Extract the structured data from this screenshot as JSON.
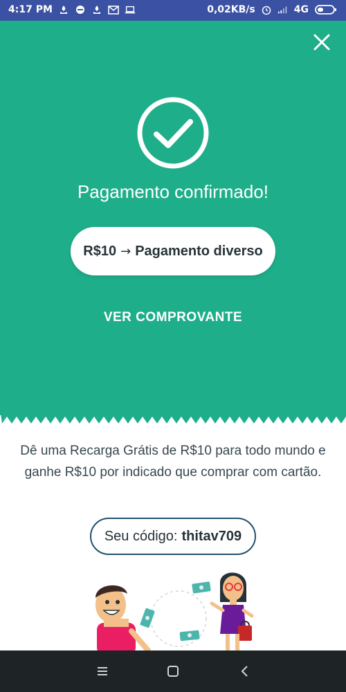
{
  "status_bar": {
    "time": "4:17 PM",
    "network_speed": "0,02KB/s",
    "network_type": "4G",
    "left_icons": [
      "santander-icon",
      "blocked-icon",
      "santander-icon",
      "mail-icon",
      "laptop-icon"
    ],
    "right_icons": [
      "alarm-icon",
      "signal-icon",
      "battery-icon"
    ]
  },
  "hero": {
    "title": "Pagamento confirmado!",
    "payment_amount": "R$10",
    "payment_arrow": "→",
    "payment_description": "Pagamento diverso",
    "receipt_link": "VER COMPROVANTE",
    "background_color": "#1fae8a"
  },
  "promo": {
    "text": "Dê uma Recarga Grátis de R$10 para todo mundo e ganhe R$10 por indicado que comprar com cartão.",
    "code_label": "Seu código:",
    "code_value": "thitav709"
  },
  "nav": {
    "icons": [
      "menu-icon",
      "home-icon",
      "back-icon"
    ]
  }
}
